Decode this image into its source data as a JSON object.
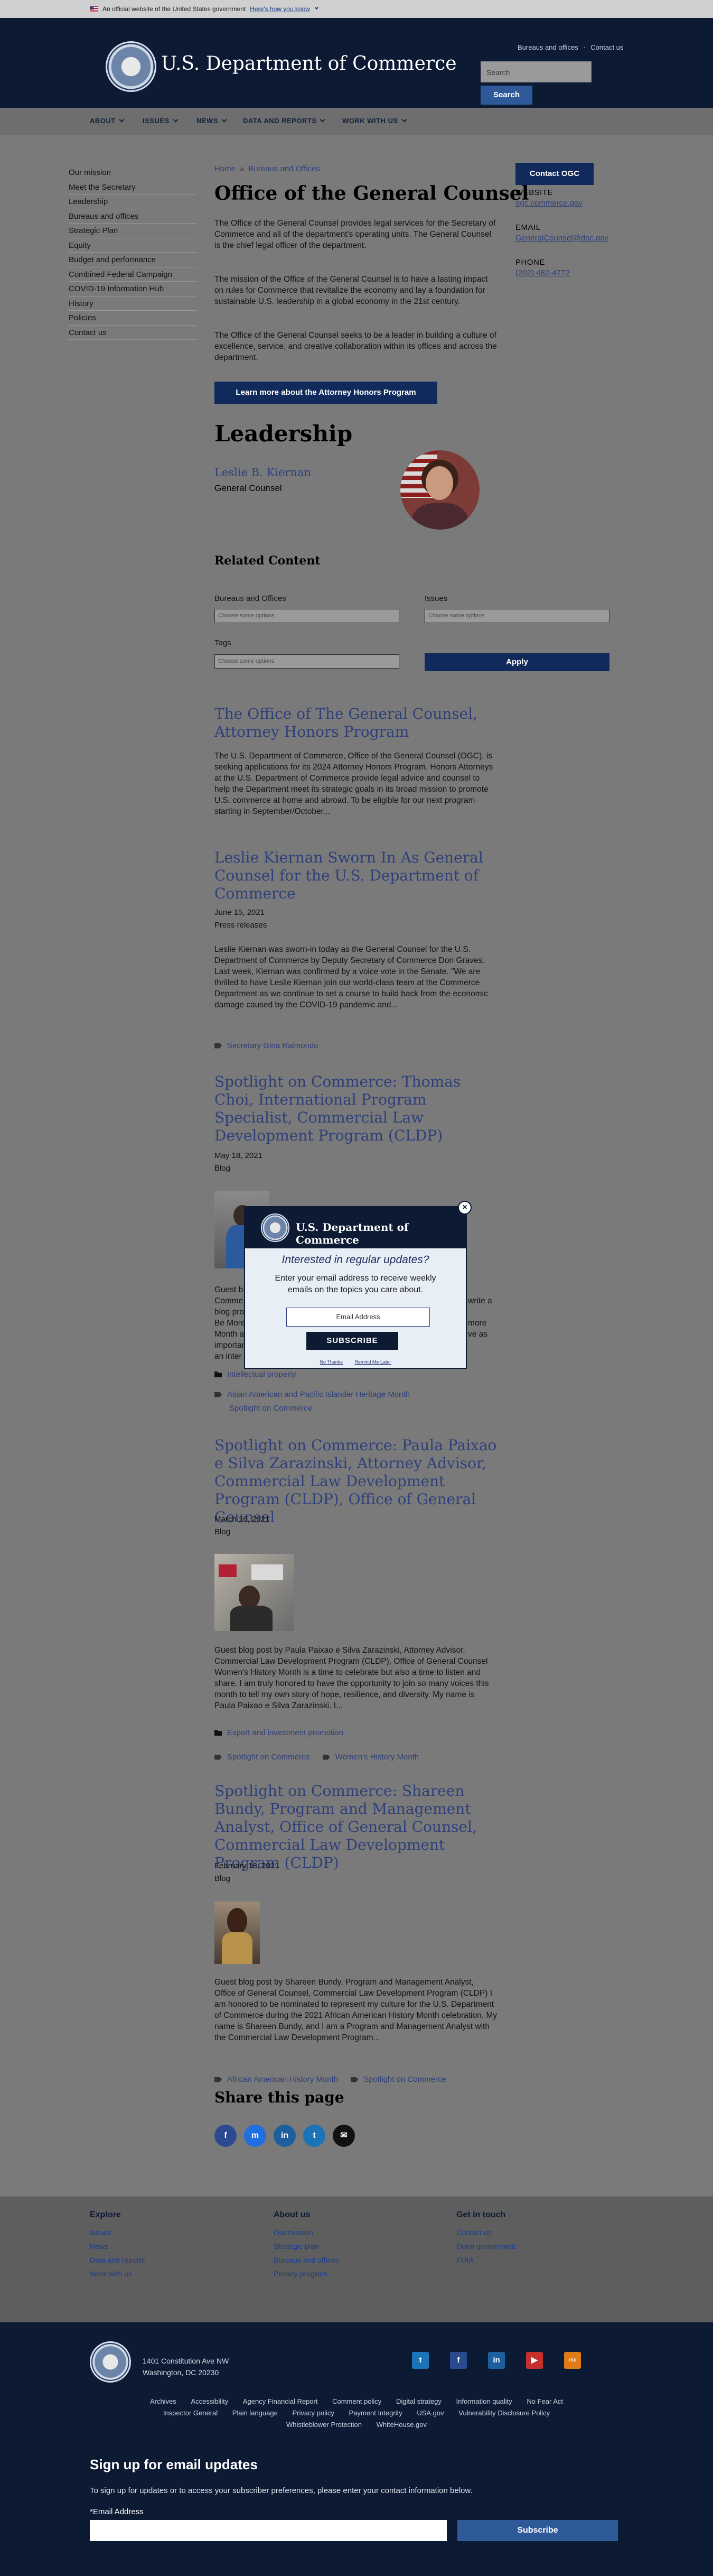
{
  "gov_banner": {
    "text": "An official website of the United States government",
    "link": "Here's how you know"
  },
  "header": {
    "title": "U.S. Department of Commerce",
    "links": [
      "Bureaus and offices",
      "·",
      "Contact us"
    ],
    "search_placeholder": "Search",
    "search_button": "Search"
  },
  "nav": [
    "ABOUT",
    "ISSUES",
    "NEWS",
    "DATA AND REPORTS",
    "WORK WITH US"
  ],
  "sidebar": [
    "Our mission",
    "Meet the Secretary",
    "Leadership",
    "Bureaus and offices",
    "Strategic Plan",
    "Equity",
    "Budget and performance",
    "Combined Federal Campaign",
    "COVID-19 Information Hub",
    "History",
    "Policies",
    "Contact us"
  ],
  "breadcrumb": {
    "home": "Home",
    "sep": "»",
    "current": "Bureaus and Offices"
  },
  "page_title": "Office of the General Counsel",
  "intro": [
    "The Office of the General Counsel provides legal services for the Secretary of Commerce and all of the department's operating units. The General Counsel is the chief legal officer of the department.",
    "The mission of the Office of the General Counsel is to have a lasting impact on rules for Commerce that revitalize the economy and lay a foundation for sustainable U.S. leadership in a global economy in the 21st century.",
    "The Office of the General Counsel seeks to be a leader in building a culture of excellence, service, and creative collaboration within its offices and across the department."
  ],
  "attorney_button": "Learn more about the Attorney Honors Program",
  "contact": {
    "button": "Contact OGC",
    "website_label": "WEBSITE",
    "website": "ogc.commerce.gov",
    "email_label": "EMAIL",
    "email": "GeneralCounsel@doc.gov",
    "phone_label": "PHONE",
    "phone": "(202) 482-4772"
  },
  "leadership": {
    "heading": "Leadership",
    "name": "Leslie B. Kiernan",
    "title": "General Counsel"
  },
  "related": {
    "heading": "Related Content",
    "bureaus_label": "Bureaus and Offices",
    "bureaus_placeholder": "Choose some options",
    "issues_label": "Issues",
    "issues_placeholder": "Choose some options",
    "tags_label": "Tags",
    "tags_placeholder": "Choose some options",
    "apply": "Apply"
  },
  "articles": [
    {
      "title": "The Office of The General Counsel, Attorney Honors Program",
      "excerpt": "The U.S. Department of Commerce, Office of the General Counsel (OGC), is seeking applications for its 2024 Attorney Honors Program. Honors Attorneys at the U.S. Department of Commerce provide legal advice and counsel to help the Department meet its strategic goals in its broad mission to promote U.S. commerce at home and abroad. To be eligible for our next program starting in September/October..."
    },
    {
      "title": "Leslie Kiernan Sworn In As General Counsel for the U.S. Department of Commerce",
      "date": "June 15, 2021",
      "type": "Press releases",
      "excerpt": "Leslie Kiernan was sworn-in today as the General Counsel for the U.S. Department of Commerce by Deputy Secretary of Commerce Don Graves. Last week, Kiernan was confirmed by a voice vote in the Senate. \"We are thrilled to have Leslie Kiernan join our world-class team at the Commerce Department as we continue to set a course to build back from the economic damage caused by the COVID-19 pandemic and...",
      "tags": [
        "Secretary Gina Raimondo"
      ]
    },
    {
      "title": "Spotlight on Commerce: Thomas Choi, International Program Specialist, Commercial Law Development Program (CLDP)",
      "date": "May 18, 2021",
      "type": "Blog",
      "excerpt_lines": [
        "Guest b",
        "Comme",
        "blog pro",
        "Be More",
        "Month a",
        "importan",
        "an inter"
      ],
      "excerpt_right": [
        "write a",
        "more",
        "ve as"
      ],
      "category": "Intellectual property",
      "tags": [
        "Asian American and Pacific Islander Heritage Month",
        "Spotlight on Commerce"
      ]
    },
    {
      "title": "Spotlight on Commerce: Paula Paixao e Silva Zarazinski, Attorney Advisor, Commercial Law Development Program (CLDP), Office of General Counsel",
      "date": "March 16, 2021",
      "type": "Blog",
      "excerpt": "Guest blog post by Paula Paixao e Silva Zarazinski, Attorney Advisor, Commercial Law Development Program (CLDP), Office of General Counsel Women's History Month is a time to celebrate but also a time to listen and share. I am truly honored to have the opportunity to join so many voices this month to tell my own story of hope, resilience, and diversity. My name is Paula Paixao e Silva Zarazinski. I...",
      "category": "Export and investment promotion",
      "tags": [
        "Spotlight on Commerce",
        "Women's History Month"
      ]
    },
    {
      "title": "Spotlight on Commerce: Shareen Bundy, Program and Management Analyst, Office of General Counsel, Commercial Law Development Program (CLDP)",
      "date": "February 18, 2021",
      "type": "Blog",
      "excerpt": "Guest blog post by Shareen Bundy, Program and Management Analyst, Office of General Counsel, Commercial Law Development Program (CLDP) I am honored to be nominated to represent my culture for the U.S. Department of Commerce during the 2021 African American History Month celebration. My name is Shareen Bundy, and I am a Program and Management Analyst with the Commercial Law Development Program...",
      "tags": [
        "African American History Month",
        "Spotlight on Commerce"
      ]
    }
  ],
  "share": {
    "heading": "Share this page",
    "icons": [
      "f",
      "m",
      "in",
      "t",
      "✉"
    ]
  },
  "footer": {
    "explore": {
      "heading": "Explore",
      "links": [
        "Issues",
        "News",
        "Data and reports",
        "Work with us"
      ]
    },
    "about": {
      "heading": "About us",
      "links": [
        "Our mission",
        "Strategic plan",
        "Bureaus and offices",
        "Privacy program"
      ]
    },
    "touch": {
      "heading": "Get in touch",
      "links": [
        "Contact us",
        "Open government",
        "FOIA"
      ]
    },
    "address": [
      "1401 Constitution Ave NW",
      "Washington, DC 20230"
    ],
    "social": [
      "t",
      "f",
      "in",
      "▶",
      "rss"
    ],
    "links_row1": [
      "Archives",
      "Accessibility",
      "Agency Financial Report",
      "Comment policy",
      "Digital strategy",
      "Information quality",
      "No Fear Act"
    ],
    "links_row2": [
      "Inspector General",
      "Plain language",
      "Privacy policy",
      "Payment Integrity",
      "USA.gov",
      "Vulnerability Disclosure Policy"
    ],
    "links_row3": [
      "Whistleblower Protection",
      "WhiteHouse.gov"
    ],
    "signup_title": "Sign up for email updates",
    "signup_text": "To sign up for updates or to access your subscriber preferences, please enter your contact information below.",
    "email_label": "*Email Address",
    "subscribe": "Subscribe"
  },
  "modal": {
    "brand": "U.S. Department of Commerce",
    "close": "×",
    "heading": "Interested in regular updates?",
    "text": "Enter your email address to receive weekly emails on the topics you care about.",
    "input_placeholder": "Email Address",
    "subscribe": "SUBSCRIBE",
    "no_thanks": "No Thanks",
    "remind": "Remind Me Later"
  },
  "colors": {
    "header_bg": "#0c1a33",
    "link": "#2e3f7a",
    "button": "#112a5c",
    "search_button": "#2f5a99"
  }
}
